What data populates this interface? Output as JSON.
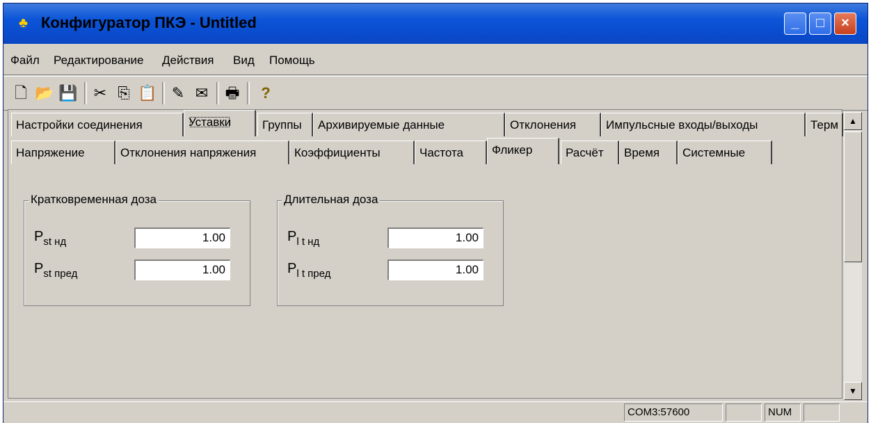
{
  "window": {
    "title": "Конфигуратор ПКЭ - Untitled",
    "min_label": "_",
    "max_label": "□",
    "close_label": "×"
  },
  "menu": [
    "Файл",
    "Редактирование",
    "Действия",
    "Вид",
    "Помощь"
  ],
  "toolbar_icons": {
    "new": "🗋",
    "open": "📂",
    "save": "💾",
    "cut": "✂",
    "copy": "⎘",
    "paste": "📋",
    "read": "✎",
    "write": "✉",
    "print": "🖶",
    "help": "?"
  },
  "tabs_top": [
    "Настройки соединения",
    "Уставки",
    "Группы",
    "Архивируемые данные",
    "Отклонения",
    "Импульсные входы/выходы",
    "Терм"
  ],
  "tabs_sub": [
    "Напряжение",
    "Отклонения напряжения",
    "Коэффициенты",
    "Частота",
    "Фликер",
    "Расчёт",
    "Время",
    "Системные"
  ],
  "short_dose": {
    "title": "Кратковременная доза",
    "rows": [
      {
        "label": "P",
        "sub": "st нд",
        "value": "1.00"
      },
      {
        "label": "P",
        "sub": "st пред",
        "value": "1.00"
      }
    ]
  },
  "long_dose": {
    "title": "Длительная доза",
    "rows": [
      {
        "label": "P",
        "sub": "l t нд",
        "value": "1.00"
      },
      {
        "label": "P",
        "sub": "l t пред",
        "value": "1.00"
      }
    ]
  },
  "status": {
    "port": "COM3:57600",
    "num": "NUM"
  },
  "scroll": {
    "up": "▲",
    "down": "▼"
  }
}
